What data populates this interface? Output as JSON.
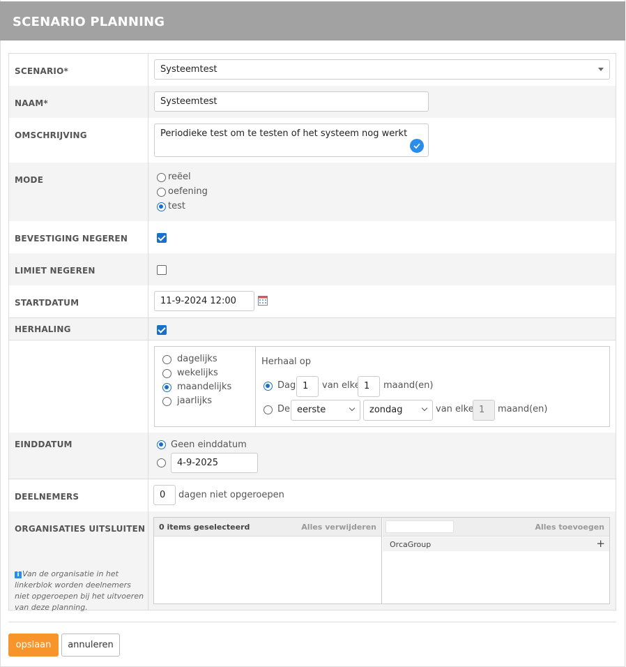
{
  "page": {
    "title": "SCENARIO PLANNING"
  },
  "fields": {
    "scenario": {
      "label": "SCENARIO*",
      "value": "Systeemtest"
    },
    "naam": {
      "label": "NAAM*",
      "value": "Systeemtest"
    },
    "omschrijving": {
      "label": "OMSCHRIJVING",
      "value": "Periodieke test om te testen of het systeem nog werkt"
    },
    "mode": {
      "label": "MODE",
      "options": [
        "reëel",
        "oefening",
        "test"
      ],
      "selected": "test"
    },
    "bevestiging": {
      "label": "BEVESTIGING NEGEREN",
      "checked": true
    },
    "limiet": {
      "label": "LIMIET NEGEREN",
      "checked": false
    },
    "startdatum": {
      "label": "STARTDATUM",
      "value": "11-9-2024 12:00"
    },
    "herhaling": {
      "label": "HERHALING",
      "checked": true,
      "frequencies": [
        "dagelijks",
        "wekelijks",
        "maandelijks",
        "jaarlijks"
      ],
      "selected": "maandelijks",
      "herhaal_op": "Herhaal op",
      "dag_label": "Dag",
      "dag_value": "1",
      "van_elke": "van elke",
      "month_value": "1",
      "maanden": "maand(en)",
      "de_label": "De",
      "ordinal": "eerste",
      "weekday": "zondag",
      "month_value2": "1"
    },
    "einddatum": {
      "label": "EINDDATUM",
      "geen": "Geen einddatum",
      "date": "4-9-2025"
    },
    "deelnemers": {
      "label": "DEELNEMERS",
      "value": "0",
      "suffix": "dagen niet opgeroepen"
    },
    "organisaties": {
      "label": "ORGANISATIES UITSLUITEN",
      "info": "Van de organisatie in het linkerblok worden deelnemers niet opgeroepen bij het uitvoeren van deze planning.",
      "selected_count": "0 items geselecteerd",
      "remove_all": "Alles verwijderen",
      "add_all": "Alles toevoegen",
      "available": [
        "OrcaGroup"
      ]
    }
  },
  "buttons": {
    "save": "opslaan",
    "cancel": "annuleren"
  },
  "colors": {
    "header": "#a2a2a2",
    "accent": "#1a6fc9",
    "save": "#f7952c"
  }
}
